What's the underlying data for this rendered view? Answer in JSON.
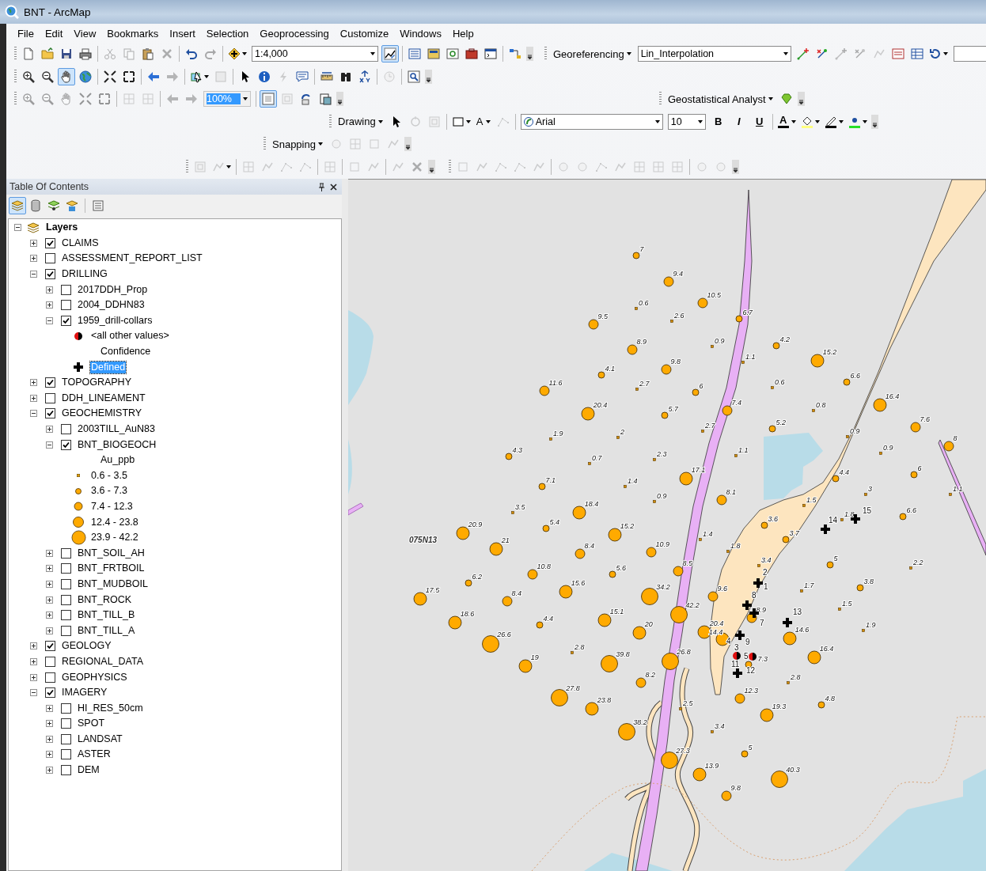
{
  "window": {
    "title": "BNT - ArcMap"
  },
  "menu": [
    "File",
    "Edit",
    "View",
    "Bookmarks",
    "Insert",
    "Selection",
    "Geoprocessing",
    "Customize",
    "Windows",
    "Help"
  ],
  "toolbar_rows": [
    {
      "toolbars": [
        {
          "items": [
            {
              "kind": "icon",
              "disabled": false,
              "pressed": false
            },
            {
              "kind": "icon",
              "disabled": false,
              "pressed": false
            },
            {
              "kind": "icon",
              "disabled": false,
              "pressed": false
            },
            {
              "kind": "icon",
              "disabled": false,
              "pressed": false
            },
            {
              "kind": "separator"
            },
            {
              "kind": "icon",
              "disabled": true,
              "pressed": false
            },
            {
              "kind": "icon",
              "disabled": true,
              "pressed": false
            },
            {
              "kind": "icon",
              "disabled": false,
              "pressed": false
            },
            {
              "kind": "icon",
              "disabled": true,
              "pressed": false
            },
            {
              "kind": "separator"
            },
            {
              "kind": "icon",
              "disabled": false,
              "pressed": false
            },
            {
              "kind": "icon",
              "disabled": true,
              "pressed": false
            },
            {
              "kind": "separator"
            },
            {
              "kind": "icon",
              "disabled": false,
              "pressed": false
            },
            {
              "kind": "combo",
              "value": "1:4,000",
              "disabled": false
            },
            {
              "kind": "icon",
              "disabled": false,
              "pressed": true
            },
            {
              "kind": "separator"
            },
            {
              "kind": "icon",
              "disabled": false,
              "pressed": false
            },
            {
              "kind": "icon",
              "disabled": false,
              "pressed": false
            },
            {
              "kind": "icon",
              "disabled": false,
              "pressed": false
            },
            {
              "kind": "icon",
              "disabled": false,
              "pressed": false
            },
            {
              "kind": "icon",
              "disabled": false,
              "pressed": false
            },
            {
              "kind": "separator"
            },
            {
              "kind": "icon",
              "disabled": false,
              "pressed": false
            }
          ]
        },
        {
          "items": [
            {
              "kind": "menu",
              "label": "Georeferencing"
            },
            {
              "kind": "combo",
              "value": "Lin_Interpolation",
              "disabled": false
            },
            {
              "kind": "icon",
              "disabled": false,
              "pressed": false
            },
            {
              "kind": "icon",
              "disabled": false,
              "pressed": false
            },
            {
              "kind": "icon",
              "disabled": true,
              "pressed": false
            },
            {
              "kind": "icon",
              "disabled": true,
              "pressed": false
            },
            {
              "kind": "icon",
              "disabled": true,
              "pressed": false
            },
            {
              "kind": "icon",
              "disabled": false,
              "pressed": false
            },
            {
              "kind": "icon",
              "disabled": false,
              "pressed": false
            },
            {
              "kind": "icon",
              "disabled": false,
              "pressed": false
            },
            {
              "kind": "field"
            }
          ]
        }
      ]
    },
    {
      "toolbars": [
        {
          "items": [
            {
              "kind": "icon",
              "disabled": false,
              "pressed": false
            },
            {
              "kind": "icon",
              "disabled": false,
              "pressed": false
            },
            {
              "kind": "icon",
              "disabled": false,
              "pressed": true
            },
            {
              "kind": "icon",
              "disabled": false,
              "pressed": false
            },
            {
              "kind": "separator"
            },
            {
              "kind": "icon",
              "disabled": false,
              "pressed": false
            },
            {
              "kind": "icon",
              "disabled": false,
              "pressed": false
            },
            {
              "kind": "separator"
            },
            {
              "kind": "icon",
              "disabled": false,
              "pressed": false
            },
            {
              "kind": "icon",
              "disabled": true,
              "pressed": false
            },
            {
              "kind": "separator"
            },
            {
              "kind": "icon",
              "disabled": false,
              "pressed": false
            },
            {
              "kind": "icon",
              "disabled": true,
              "pressed": false
            },
            {
              "kind": "separator"
            },
            {
              "kind": "icon",
              "disabled": false,
              "pressed": false
            },
            {
              "kind": "icon",
              "disabled": false,
              "pressed": false
            },
            {
              "kind": "icon",
              "disabled": true,
              "pressed": false
            },
            {
              "kind": "icon",
              "disabled": false,
              "pressed": false
            },
            {
              "kind": "separator"
            },
            {
              "kind": "icon",
              "disabled": false,
              "pressed": false
            },
            {
              "kind": "icon",
              "disabled": false,
              "pressed": false
            },
            {
              "kind": "icon",
              "disabled": false,
              "pressed": false
            },
            {
              "kind": "separator"
            },
            {
              "kind": "icon",
              "disabled": true,
              "pressed": false
            },
            {
              "kind": "separator"
            },
            {
              "kind": "icon",
              "disabled": false,
              "pressed": false
            }
          ]
        }
      ]
    },
    {
      "toolbars": [
        {
          "items": [
            {
              "kind": "icon",
              "disabled": true,
              "pressed": false
            },
            {
              "kind": "icon",
              "disabled": true,
              "pressed": false
            },
            {
              "kind": "icon",
              "disabled": true,
              "pressed": false
            },
            {
              "kind": "icon",
              "disabled": true,
              "pressed": false
            },
            {
              "kind": "icon",
              "disabled": true,
              "pressed": false
            },
            {
              "kind": "separator"
            },
            {
              "kind": "icon",
              "disabled": true,
              "pressed": false
            },
            {
              "kind": "icon",
              "disabled": true,
              "pressed": false
            },
            {
              "kind": "separator"
            },
            {
              "kind": "icon",
              "disabled": true,
              "pressed": false
            },
            {
              "kind": "icon",
              "disabled": true,
              "pressed": false
            },
            {
              "kind": "combo",
              "value": "100%",
              "disabled": true
            },
            {
              "kind": "separator"
            },
            {
              "kind": "icon",
              "disabled": false,
              "pressed": true
            },
            {
              "kind": "icon",
              "disabled": true,
              "pressed": false
            },
            {
              "kind": "icon",
              "disabled": false,
              "pressed": false
            },
            {
              "kind": "icon",
              "disabled": false,
              "pressed": false
            }
          ]
        },
        {
          "items": [
            {
              "kind": "menu",
              "label": "Geostatistical Analyst"
            },
            {
              "kind": "icon",
              "disabled": false,
              "pressed": false
            }
          ]
        }
      ]
    },
    {
      "toolbars": [
        {
          "items": [
            {
              "kind": "menu",
              "label": "Drawing"
            },
            {
              "kind": "icon",
              "disabled": false,
              "pressed": false
            },
            {
              "kind": "icon",
              "disabled": true,
              "pressed": false
            },
            {
              "kind": "icon",
              "disabled": true,
              "pressed": false
            },
            {
              "kind": "separator"
            },
            {
              "kind": "icon",
              "disabled": false,
              "pressed": false
            },
            {
              "kind": "text-button",
              "label": "A",
              "disabled": false
            },
            {
              "kind": "icon",
              "disabled": true,
              "pressed": false
            },
            {
              "kind": "separator"
            },
            {
              "kind": "combo",
              "value": "Arial",
              "disabled": false
            },
            {
              "kind": "combo",
              "value": "10",
              "disabled": false
            },
            {
              "kind": "text-button",
              "label": "B",
              "disabled": false
            },
            {
              "kind": "text-button",
              "label": "I",
              "disabled": false
            },
            {
              "kind": "text-button",
              "label": "U",
              "disabled": false
            },
            {
              "kind": "separator"
            },
            {
              "kind": "text-button",
              "label": "A",
              "disabled": false
            },
            {
              "kind": "icon",
              "disabled": false,
              "pressed": false
            },
            {
              "kind": "icon",
              "disabled": false,
              "pressed": false
            },
            {
              "kind": "icon",
              "disabled": false,
              "pressed": false
            }
          ]
        }
      ]
    },
    {
      "toolbars": [
        {
          "items": [
            {
              "kind": "menu",
              "label": "Snapping"
            },
            {
              "kind": "icon",
              "disabled": true,
              "pressed": false
            },
            {
              "kind": "icon",
              "disabled": true,
              "pressed": false
            },
            {
              "kind": "icon",
              "disabled": true,
              "pressed": false
            },
            {
              "kind": "icon",
              "disabled": true,
              "pressed": false
            }
          ]
        }
      ]
    },
    {
      "toolbars": [
        {
          "items": [
            {
              "kind": "icon",
              "disabled": true,
              "pressed": false
            },
            {
              "kind": "icon",
              "disabled": true,
              "pressed": false
            },
            {
              "kind": "separator"
            },
            {
              "kind": "icon",
              "disabled": true,
              "pressed": false
            },
            {
              "kind": "icon",
              "disabled": true,
              "pressed": false
            },
            {
              "kind": "icon",
              "disabled": true,
              "pressed": false
            },
            {
              "kind": "icon",
              "disabled": true,
              "pressed": false
            },
            {
              "kind": "separator"
            },
            {
              "kind": "icon",
              "disabled": true,
              "pressed": false
            },
            {
              "kind": "separator"
            },
            {
              "kind": "icon",
              "disabled": true,
              "pressed": false
            },
            {
              "kind": "icon",
              "disabled": true,
              "pressed": false
            },
            {
              "kind": "separator"
            },
            {
              "kind": "icon",
              "disabled": true,
              "pressed": false
            },
            {
              "kind": "icon",
              "disabled": true,
              "pressed": false
            }
          ]
        },
        {
          "items": [
            {
              "kind": "icon",
              "disabled": true,
              "pressed": false
            },
            {
              "kind": "icon",
              "disabled": true,
              "pressed": false
            },
            {
              "kind": "icon",
              "disabled": true,
              "pressed": false
            },
            {
              "kind": "icon",
              "disabled": true,
              "pressed": false
            },
            {
              "kind": "icon",
              "disabled": true,
              "pressed": false
            },
            {
              "kind": "separator"
            },
            {
              "kind": "icon",
              "disabled": true,
              "pressed": false
            },
            {
              "kind": "icon",
              "disabled": true,
              "pressed": false
            },
            {
              "kind": "icon",
              "disabled": true,
              "pressed": false
            },
            {
              "kind": "icon",
              "disabled": true,
              "pressed": false
            },
            {
              "kind": "icon",
              "disabled": true,
              "pressed": false
            },
            {
              "kind": "icon",
              "disabled": true,
              "pressed": false
            },
            {
              "kind": "icon",
              "disabled": true,
              "pressed": false
            },
            {
              "kind": "separator"
            },
            {
              "kind": "icon",
              "disabled": true,
              "pressed": false
            },
            {
              "kind": "icon",
              "disabled": true,
              "pressed": false
            }
          ]
        }
      ]
    }
  ],
  "toc": {
    "title": "Table Of Contents",
    "views": [
      {
        "selected": true
      },
      {
        "selected": false
      },
      {
        "selected": false
      },
      {
        "selected": false
      },
      {
        "selected": false
      }
    ],
    "tree": {
      "kind": "group",
      "label": "Layers",
      "expanded": true,
      "selected": false,
      "children": [
        {
          "kind": "layer",
          "label": "CLAIMS",
          "checked": true,
          "expanded": false,
          "selected": false
        },
        {
          "kind": "layer",
          "label": "ASSESSMENT_REPORT_LIST",
          "checked": false,
          "expanded": false,
          "selected": false
        },
        {
          "kind": "layer",
          "label": "DRILLING",
          "checked": true,
          "expanded": true,
          "selected": false,
          "children": [
            {
              "kind": "layer",
              "label": "2017DDH_Prop",
              "checked": false,
              "expanded": false,
              "selected": false
            },
            {
              "kind": "layer",
              "label": "2004_DDHN83",
              "checked": false,
              "expanded": false,
              "selected": false
            },
            {
              "kind": "layer",
              "label": "1959_drill-collars",
              "checked": true,
              "expanded": true,
              "selected": false,
              "children": [
                {
                  "kind": "legend-other",
                  "label": "<all other values>",
                  "selected": false
                },
                {
                  "kind": "legend-heading",
                  "label": "Confidence",
                  "selected": false
                },
                {
                  "kind": "legend-cross",
                  "label": "Defined",
                  "selected": true
                }
              ]
            }
          ]
        },
        {
          "kind": "layer",
          "label": "TOPOGRAPHY",
          "checked": true,
          "expanded": false,
          "selected": false
        },
        {
          "kind": "layer",
          "label": "DDH_LINEAMENT",
          "checked": false,
          "expanded": false,
          "selected": false
        },
        {
          "kind": "layer",
          "label": "GEOCHEMISTRY",
          "checked": true,
          "expanded": true,
          "selected": false,
          "children": [
            {
              "kind": "layer",
              "label": "2003TILL_AuN83",
              "checked": false,
              "expanded": false,
              "selected": false
            },
            {
              "kind": "layer",
              "label": "BNT_BIOGEOCH",
              "checked": true,
              "expanded": true,
              "selected": false,
              "children": [
                {
                  "kind": "legend-heading",
                  "label": "Au_ppb",
                  "selected": false
                },
                {
                  "kind": "legend-xs",
                  "label": "0.6 - 3.5",
                  "selected": false
                },
                {
                  "kind": "legend-s",
                  "label": "3.6 - 7.3",
                  "selected": false
                },
                {
                  "kind": "legend-m",
                  "label": "7.4 - 12.3",
                  "selected": false
                },
                {
                  "kind": "legend-l",
                  "label": "12.4 - 23.8",
                  "selected": false
                },
                {
                  "kind": "legend-xl",
                  "label": "23.9 - 42.2",
                  "selected": false
                }
              ]
            },
            {
              "kind": "layer",
              "label": "BNT_SOIL_AH",
              "checked": false,
              "expanded": false,
              "selected": false
            },
            {
              "kind": "layer",
              "label": "BNT_FRTBOIL",
              "checked": false,
              "expanded": false,
              "selected": false
            },
            {
              "kind": "layer",
              "label": "BNT_MUDBOIL",
              "checked": false,
              "expanded": false,
              "selected": false
            },
            {
              "kind": "layer",
              "label": "BNT_ROCK",
              "checked": false,
              "expanded": false,
              "selected": false
            },
            {
              "kind": "layer",
              "label": "BNT_TILL_B",
              "checked": false,
              "expanded": false,
              "selected": false
            },
            {
              "kind": "layer",
              "label": "BNT_TILL_A",
              "checked": false,
              "expanded": false,
              "selected": false
            }
          ]
        },
        {
          "kind": "layer",
          "label": "GEOLOGY",
          "checked": true,
          "expanded": false,
          "selected": false
        },
        {
          "kind": "layer",
          "label": "REGIONAL_DATA",
          "checked": false,
          "expanded": false,
          "selected": false
        },
        {
          "kind": "layer",
          "label": "GEOPHYSICS",
          "checked": false,
          "expanded": false,
          "selected": false
        },
        {
          "kind": "layer",
          "label": "IMAGERY",
          "checked": true,
          "expanded": true,
          "selected": false,
          "children": [
            {
              "kind": "layer",
              "label": "HI_RES_50cm",
              "checked": false,
              "expanded": false,
              "selected": false
            },
            {
              "kind": "layer",
              "label": "SPOT",
              "checked": false,
              "expanded": false,
              "selected": false
            },
            {
              "kind": "layer",
              "label": "LANDSAT",
              "checked": false,
              "expanded": false,
              "selected": false
            },
            {
              "kind": "layer",
              "label": "ASTER",
              "checked": false,
              "expanded": false,
              "selected": false
            },
            {
              "kind": "layer",
              "label": "DEM",
              "checked": false,
              "expanded": false,
              "selected": false
            }
          ]
        }
      ]
    }
  },
  "map": {
    "sheet_label": "075N13",
    "samples": [
      {
        "label": "7",
        "kind": "s"
      },
      {
        "label": "9.4",
        "kind": "m"
      },
      {
        "label": "0.6",
        "kind": "xs"
      },
      {
        "label": "10.5",
        "kind": "m"
      },
      {
        "label": "9.5",
        "kind": "m"
      },
      {
        "label": "2.6",
        "kind": "xs"
      },
      {
        "label": "6.7",
        "kind": "s"
      },
      {
        "label": "8.9",
        "kind": "m"
      },
      {
        "label": "0.9",
        "kind": "xs"
      },
      {
        "label": "4.2",
        "kind": "s"
      },
      {
        "label": "1.1",
        "kind": "xs"
      },
      {
        "label": "15.2",
        "kind": "l"
      },
      {
        "label": "4.1",
        "kind": "s"
      },
      {
        "label": "9.8",
        "kind": "m"
      },
      {
        "label": "0.6",
        "kind": "xs"
      },
      {
        "label": "6.6",
        "kind": "s"
      },
      {
        "label": "11.6",
        "kind": "m"
      },
      {
        "label": "2.7",
        "kind": "xs"
      },
      {
        "label": "6",
        "kind": "s"
      },
      {
        "label": "7.4",
        "kind": "m"
      },
      {
        "label": "0.8",
        "kind": "xs"
      },
      {
        "label": "16.4",
        "kind": "l"
      },
      {
        "label": "20.4",
        "kind": "l"
      },
      {
        "label": "5.7",
        "kind": "s"
      },
      {
        "label": "2.7",
        "kind": "xs"
      },
      {
        "label": "5.2",
        "kind": "s"
      },
      {
        "label": "7.6",
        "kind": "m"
      },
      {
        "label": "1.9",
        "kind": "xs"
      },
      {
        "label": "2",
        "kind": "xs"
      },
      {
        "label": "0.9",
        "kind": "xs"
      },
      {
        "label": "8",
        "kind": "m"
      },
      {
        "label": "4.3",
        "kind": "s"
      },
      {
        "label": "2.3",
        "kind": "xs"
      },
      {
        "label": "1.1",
        "kind": "xs"
      },
      {
        "label": "0.9",
        "kind": "xs"
      },
      {
        "label": "0.7",
        "kind": "xs"
      },
      {
        "label": "17.1",
        "kind": "l"
      },
      {
        "label": "4.4",
        "kind": "s"
      },
      {
        "label": "6",
        "kind": "s"
      },
      {
        "label": "7.1",
        "kind": "s"
      },
      {
        "label": "1.4",
        "kind": "xs"
      },
      {
        "label": "3",
        "kind": "xs"
      },
      {
        "label": "1.1",
        "kind": "xs"
      },
      {
        "label": "0.9",
        "kind": "xs"
      },
      {
        "label": "8.1",
        "kind": "m"
      },
      {
        "label": "1.5",
        "kind": "xs"
      },
      {
        "label": "3.5",
        "kind": "xs"
      },
      {
        "label": "18.4",
        "kind": "l"
      },
      {
        "label": "6.6",
        "kind": "s"
      },
      {
        "label": "3.6",
        "kind": "s"
      },
      {
        "label": "1.8",
        "kind": "xs"
      },
      {
        "label": "20.9",
        "kind": "l"
      },
      {
        "label": "5.4",
        "kind": "s"
      },
      {
        "label": "15.2",
        "kind": "l"
      },
      {
        "label": "1.4",
        "kind": "xs"
      },
      {
        "label": "3.7",
        "kind": "s"
      },
      {
        "label": "21",
        "kind": "l"
      },
      {
        "label": "8.4",
        "kind": "m"
      },
      {
        "label": "10.9",
        "kind": "m"
      },
      {
        "label": "1.8",
        "kind": "xs"
      },
      {
        "label": "3.4",
        "kind": "xs"
      },
      {
        "label": "5",
        "kind": "s"
      },
      {
        "label": "2.2",
        "kind": "xs"
      },
      {
        "label": "10.8",
        "kind": "m"
      },
      {
        "label": "5.6",
        "kind": "s"
      },
      {
        "label": "8.5",
        "kind": "m"
      },
      {
        "label": "6.2",
        "kind": "s"
      },
      {
        "label": "3.8",
        "kind": "s"
      },
      {
        "label": "15.6",
        "kind": "l"
      },
      {
        "label": "34.2",
        "kind": "xl"
      },
      {
        "label": "9.6",
        "kind": "m"
      },
      {
        "label": "1.7",
        "kind": "xs"
      },
      {
        "label": "17.5",
        "kind": "l"
      },
      {
        "label": "8.4",
        "kind": "m"
      },
      {
        "label": "42.2",
        "kind": "xl"
      },
      {
        "label": "1.5",
        "kind": "xs"
      },
      {
        "label": "18.6",
        "kind": "l"
      },
      {
        "label": "15.1",
        "kind": "l"
      },
      {
        "label": "8.9",
        "kind": "m"
      },
      {
        "label": "4.4",
        "kind": "s"
      },
      {
        "label": "20",
        "kind": "l"
      },
      {
        "label": "20.4",
        "kind": "l"
      },
      {
        "label": "14.6",
        "kind": "l"
      },
      {
        "label": "1.9",
        "kind": "xs"
      },
      {
        "label": "26.6",
        "kind": "xl"
      },
      {
        "label": "14.4",
        "kind": "l"
      },
      {
        "label": "2.8",
        "kind": "xs"
      },
      {
        "label": "16.4",
        "kind": "l"
      },
      {
        "label": "19",
        "kind": "l"
      },
      {
        "label": "39.8",
        "kind": "xl"
      },
      {
        "label": "26.8",
        "kind": "xl"
      },
      {
        "label": "7.3",
        "kind": "s"
      },
      {
        "label": "8.2",
        "kind": "m"
      },
      {
        "label": "2.8",
        "kind": "xs"
      },
      {
        "label": "27.8",
        "kind": "xl"
      },
      {
        "label": "12.3",
        "kind": "m"
      },
      {
        "label": "23.8",
        "kind": "l"
      },
      {
        "label": "2.5",
        "kind": "xs"
      },
      {
        "label": "4.8",
        "kind": "s"
      },
      {
        "label": "19.3",
        "kind": "l"
      },
      {
        "label": "38.2",
        "kind": "xl"
      },
      {
        "label": "3.4",
        "kind": "xs"
      },
      {
        "label": "5",
        "kind": "s"
      },
      {
        "label": "27.3",
        "kind": "xl"
      },
      {
        "label": "13.9",
        "kind": "l"
      },
      {
        "label": "40.3",
        "kind": "xl"
      },
      {
        "label": "9.8",
        "kind": "m"
      }
    ],
    "collars": [
      {
        "label": "15",
        "kind": "defined"
      },
      {
        "label": "14",
        "kind": "defined"
      },
      {
        "label": "2",
        "kind": "unmarked"
      },
      {
        "label": "1",
        "kind": "defined"
      },
      {
        "label": "8",
        "kind": "defined"
      },
      {
        "label": "7",
        "kind": "defined"
      },
      {
        "label": "13",
        "kind": "defined"
      },
      {
        "label": "4",
        "kind": "unmarked"
      },
      {
        "label": "9",
        "kind": "defined"
      },
      {
        "label": "3",
        "kind": "other"
      },
      {
        "label": "5",
        "kind": "other"
      },
      {
        "label": "11",
        "kind": "unmarked"
      },
      {
        "label": "12",
        "kind": "defined"
      }
    ]
  }
}
